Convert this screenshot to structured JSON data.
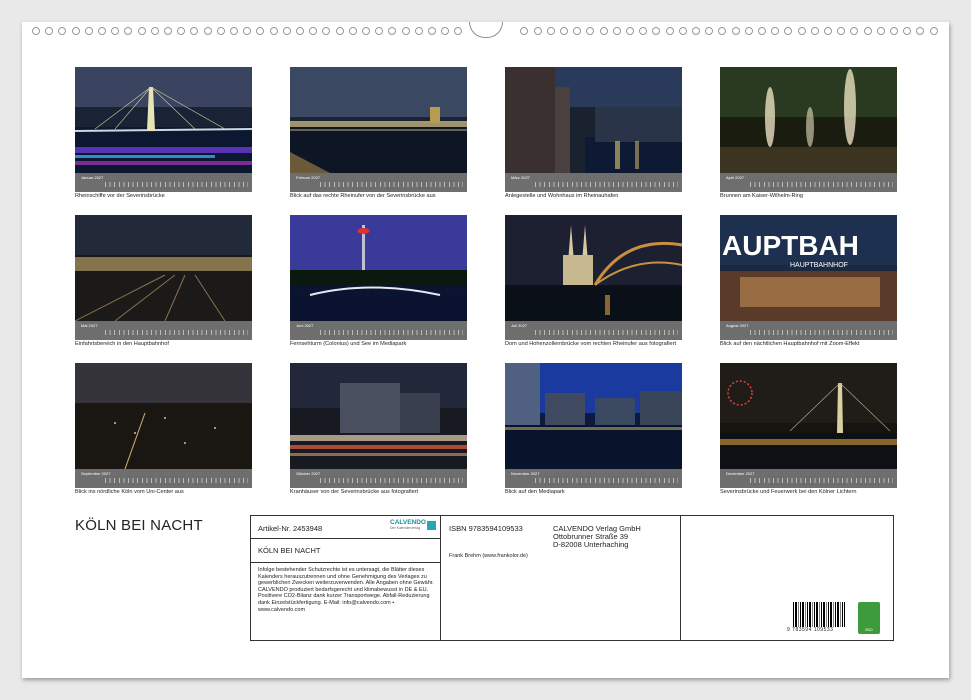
{
  "title": "KÖLN BEI NACHT",
  "months": [
    {
      "label": "Januar 2027",
      "caption": "Rheinschiffe vor der Severinsbrücke"
    },
    {
      "label": "Februar 2027",
      "caption": "Blick auf das rechte Rheinufer von der Severinsbrücke aus"
    },
    {
      "label": "März 2027",
      "caption": "Anlegestelle und Wohnhaus im Rheinauhafen"
    },
    {
      "label": "April 2027",
      "caption": "Brunnen am Kaiser-Wilhelm-Ring"
    },
    {
      "label": "Mai 2027",
      "caption": "Einfahrtsbereich in den Hauptbahnhof"
    },
    {
      "label": "Juni 2027",
      "caption": "Fernsehturm (Colonius) und See im Mediapark"
    },
    {
      "label": "Juli 2027",
      "caption": "Dom und Hohenzollernbrücke vom rechten Rheinufer aus fotografiert"
    },
    {
      "label": "August 2027",
      "caption": "Blick auf den nächtlichen Hauptbahnhof mit Zoom-Effekt"
    },
    {
      "label": "September 2027",
      "caption": "Blick ins nördliche Köln vom Uni-Center aus"
    },
    {
      "label": "Oktober 2027",
      "caption": "Kranhäuser von der Severinsbrücke aus fotografiert"
    },
    {
      "label": "November 2027",
      "caption": "Blick auf den Mediapark"
    },
    {
      "label": "Dezember 2027",
      "caption": "Severinsbrücke und Feuerwerk bei den Kölner Lichtern"
    }
  ],
  "photo_text": {
    "hbf_sign": "AUPTBAH",
    "hbf_small": "HAUPTBAHNHOF"
  },
  "info": {
    "article": "Artikel-Nr. 2453948",
    "logo": "CALVENDO",
    "logo_sub": "Der Kalenderverlag",
    "title": "KÖLN BEI NACHT",
    "legal": "Infolge bestehender Schutzrechte ist es untersagt, die Blätter dieses Kalenders herauszutrennen und ohne Genehmigung des Verlages zu gewerblichen Zwecken weiterzuverwenden. Alle Angaben ohne Gewähr. CALVENDO produziert bedarfsgerecht und klimabewusst in DE & EU. Positivere CO2-Bilanz dank kurzer Transportwege. Abfall-Reduzierung dank Einzelstückfertigung. E-Mail: info@calvendo.com • www.calvendo.com",
    "isbn": "ISBN 9783594109533",
    "author": "Frank Brehm (www.frankolor.de)",
    "publisher1": "CALVENDO Verlag GmbH",
    "publisher2": "Ottobrunner Straße 39",
    "publisher3": "D-82008 Unterhaching",
    "barcode_num": "9 783594 109533",
    "eco": "eco"
  }
}
